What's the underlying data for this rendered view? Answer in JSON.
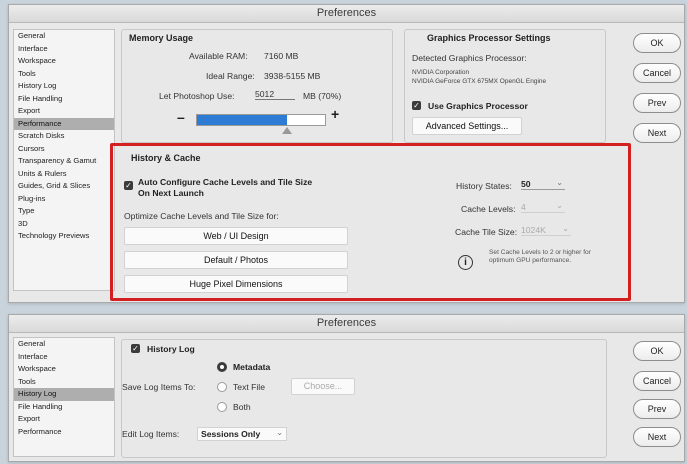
{
  "top": {
    "title": "Preferences",
    "sidebar": [
      "General",
      "Interface",
      "Workspace",
      "Tools",
      "History Log",
      "File Handling",
      "Export",
      "Performance",
      "Scratch Disks",
      "Cursors",
      "Transparency & Gamut",
      "Units & Rulers",
      "Guides, Grid & Slices",
      "Plug-ins",
      "Type",
      "3D",
      "Technology Previews"
    ],
    "selected_index": 7,
    "memory": {
      "header": "Memory Usage",
      "available_label": "Available RAM:",
      "available_value": "7160 MB",
      "ideal_label": "Ideal Range:",
      "ideal_value": "3938-5155 MB",
      "let_label": "Let Photoshop Use:",
      "let_value": "5012",
      "let_unit": "MB (70%)",
      "minus": "–",
      "plus": "+",
      "slider_fraction": 0.7
    },
    "gpu": {
      "header": "Graphics Processor Settings",
      "detected_label": "Detected Graphics Processor:",
      "vendor": "NVIDIA Corporation",
      "model": "NVIDIA GeForce GTX 675MX OpenGL Engine",
      "use_label": "Use Graphics Processor",
      "advanced_button": "Advanced Settings..."
    },
    "history": {
      "header": "History & Cache",
      "auto_label_line1": "Auto Configure Cache Levels and Tile Size",
      "auto_label_line2": "On Next Launch",
      "optimize_label": "Optimize Cache Levels and Tile Size for:",
      "buttons": [
        "Web / UI Design",
        "Default / Photos",
        "Huge Pixel Dimensions"
      ],
      "states_label": "History States:",
      "states_value": "50",
      "levels_label": "Cache Levels:",
      "levels_value": "4",
      "tile_label": "Cache Tile Size:",
      "tile_value": "1024K",
      "info_line1": "Set Cache Levels to 2 or higher for",
      "info_line2": "optimum GPU performance."
    },
    "buttons": {
      "ok": "OK",
      "cancel": "Cancel",
      "prev": "Prev",
      "next": "Next"
    },
    "chevron": "⌄",
    "info_glyph": "i",
    "check_glyph": "✓"
  },
  "bottom": {
    "title": "Preferences",
    "sidebar": [
      "General",
      "Interface",
      "Workspace",
      "Tools",
      "History Log",
      "File Handling",
      "Export",
      "Performance"
    ],
    "selected_index": 4,
    "history_log_label": "History Log",
    "save_label": "Save Log Items To:",
    "options": [
      "Metadata",
      "Text File",
      "Both"
    ],
    "choose_button": "Choose...",
    "edit_label": "Edit Log Items:",
    "edit_value": "Sessions Only",
    "buttons": {
      "ok": "OK",
      "cancel": "Cancel",
      "prev": "Prev",
      "next": "Next"
    }
  },
  "colors": {
    "highlight": "#d21f1f",
    "slider_fill": "#2e7bd6"
  }
}
